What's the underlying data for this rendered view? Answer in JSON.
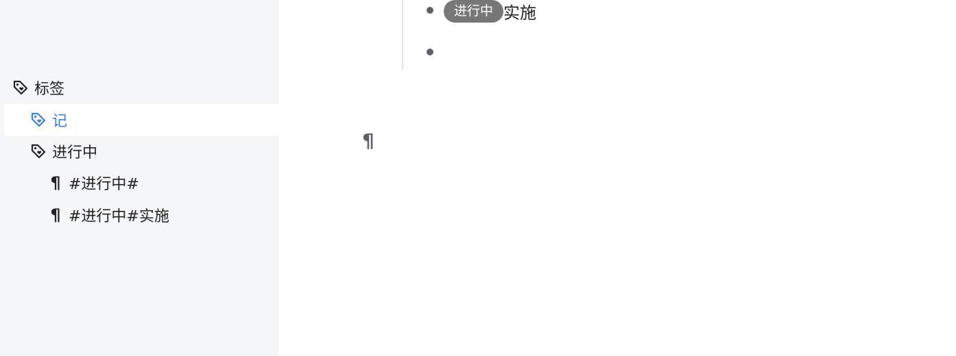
{
  "sidebar": {
    "tags_header": {
      "label": "标签",
      "icon": "tag-icon"
    },
    "tags": [
      {
        "label": "记",
        "icon": "tag-icon",
        "selected": true
      },
      {
        "label": "进行中",
        "icon": "tag-icon",
        "selected": false
      }
    ],
    "blocks": [
      {
        "label": "#进行中#",
        "icon": "pilcrow-icon"
      },
      {
        "label": "#进行中#实施",
        "icon": "pilcrow-icon"
      }
    ]
  },
  "editor": {
    "list_items": [
      {
        "tag": "进行中",
        "text": "实施"
      },
      {
        "tag": "",
        "text": ""
      }
    ],
    "paragraph_marker": "¶"
  },
  "colors": {
    "sidebar_bg": "#f5f6f8",
    "accent": "#3b7ee0",
    "tag_chip_bg": "#777777"
  }
}
